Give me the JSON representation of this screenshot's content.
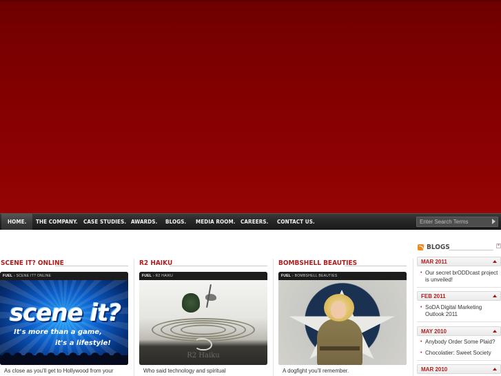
{
  "nav": {
    "items": [
      "HOME.",
      "THE COMPANY.",
      "CASE STUDIES.",
      "AWARDS.",
      "BLOGS.",
      "MEDIA ROOM.",
      "CAREERS.",
      "CONTACT US."
    ],
    "search_placeholder": "Enter Search Terms"
  },
  "columns": [
    {
      "title": "SCENE IT? ONLINE",
      "crumb_brand": "FUEL",
      "crumb_sep": " › ",
      "crumb_page": "SCENE IT? ONLINE",
      "image_text": {
        "logo": "scene it?",
        "tagline1": "It's more than a game,",
        "tagline2": "it's a lifestyle!"
      },
      "text": "As close as you'll get to Hollywood from your"
    },
    {
      "title": "R2 HAIKU",
      "crumb_brand": "FUEL",
      "crumb_sep": " › ",
      "crumb_page": "R2 HAIKU",
      "image_text": {
        "label": "R2 Haiku"
      },
      "text": "Who said technology and spiritual"
    },
    {
      "title": "BOMBSHELL BEAUTIES",
      "crumb_brand": "FUEL",
      "crumb_sep": " › ",
      "crumb_page": "BOMBSHELL BEAUTIES",
      "text": "A dogfight you'll remember."
    }
  ],
  "sidebar": {
    "title": "BLOGS",
    "close_label": "×",
    "months": [
      {
        "label": "MAR 2011",
        "posts": [
          "Our secret brODDcast project",
          "is unveiled!"
        ]
      },
      {
        "label": "FEB 2011",
        "posts": [
          "SoDA Digital Marketing",
          "Outlook 2011"
        ]
      },
      {
        "label": "MAY 2010",
        "posts": [
          "Anybody Order Some Plaid?",
          "Chocolatier: Sweet Society"
        ]
      },
      {
        "label": "MAR 2010",
        "posts": []
      }
    ]
  },
  "colors": {
    "hero_red": "#8a0000",
    "accent_red": "#b21e1e",
    "nav_dark": "#262626",
    "rss_orange": "#ef8a1f"
  },
  "icons": [
    "rss-icon",
    "close-icon",
    "chevron-up-icon",
    "arrow-right-icon"
  ]
}
